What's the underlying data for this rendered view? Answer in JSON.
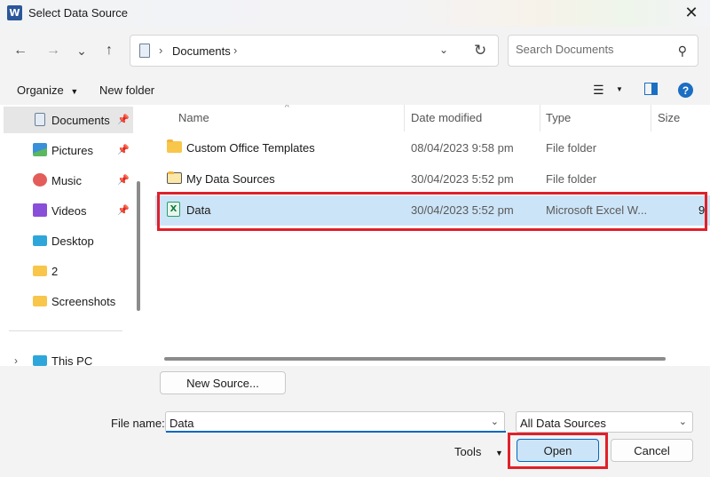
{
  "window": {
    "title": "Select Data Source",
    "app_icon_letter": "W"
  },
  "navigation": {
    "back": "←",
    "forward": "→",
    "recent": "⌄",
    "up": "↑",
    "address_path": "Documents",
    "search_placeholder": "Search Documents"
  },
  "commands": {
    "organize": "Organize",
    "new_folder": "New folder"
  },
  "sidebar": {
    "items": [
      {
        "label": "Documents",
        "icon": "documents-icon",
        "pinned": true,
        "selected": true
      },
      {
        "label": "Pictures",
        "icon": "pictures-icon",
        "pinned": true
      },
      {
        "label": "Music",
        "icon": "music-icon",
        "pinned": true
      },
      {
        "label": "Videos",
        "icon": "videos-icon",
        "pinned": true
      },
      {
        "label": "Desktop",
        "icon": "desktop-icon"
      },
      {
        "label": "2",
        "icon": "folder-icon"
      },
      {
        "label": "Screenshots",
        "icon": "folder-icon"
      },
      {
        "label": "This PC",
        "icon": "computer-icon"
      }
    ]
  },
  "columns": {
    "name": "Name",
    "date": "Date modified",
    "type": "Type",
    "size": "Size"
  },
  "files": [
    {
      "name": "Custom Office Templates",
      "date": "08/04/2023 9:58 pm",
      "type": "File folder",
      "size": ""
    },
    {
      "name": "My Data Sources",
      "date": "30/04/2023 5:52 pm",
      "type": "File folder",
      "size": ""
    },
    {
      "name": "Data",
      "date": "30/04/2023 5:52 pm",
      "type": "Microsoft Excel W...",
      "size": "9",
      "selected": true
    }
  ],
  "bottom": {
    "new_source": "New Source...",
    "file_name_label": "File name:",
    "file_name_value": "Data",
    "filter_value": "All Data Sources",
    "tools": "Tools",
    "open": "Open",
    "cancel": "Cancel"
  },
  "colors": {
    "accent": "#0067c0",
    "selection": "#cce4f7",
    "highlight": "#e0202a"
  }
}
